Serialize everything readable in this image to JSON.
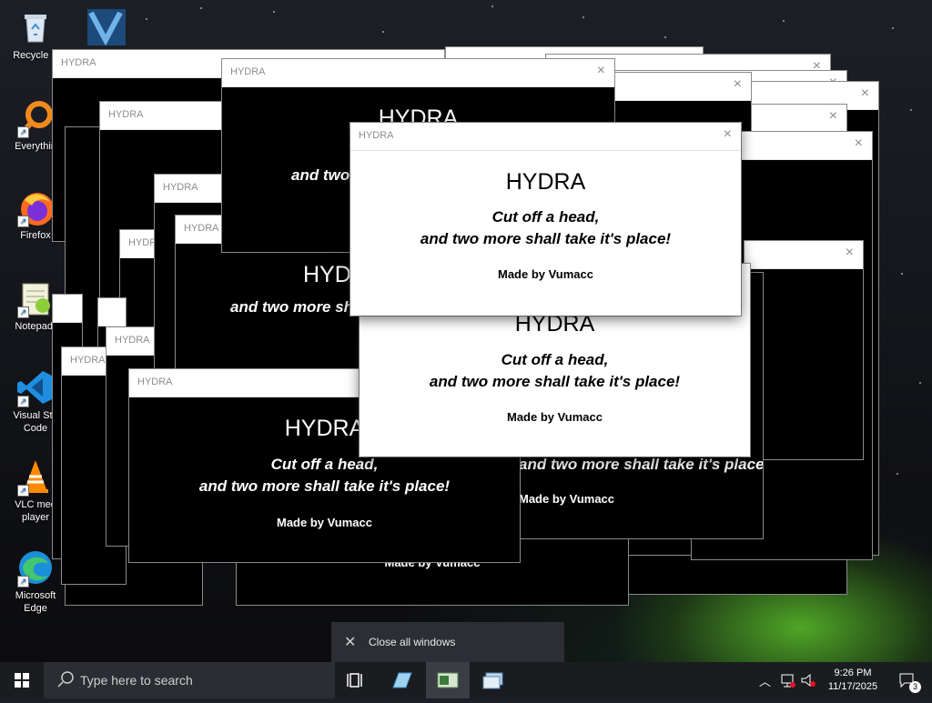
{
  "desktop_icons": [
    {
      "label": "Recycle B",
      "icon": "recycle-bin-icon"
    },
    {
      "label": "Everythin",
      "icon": "everything-search-icon"
    },
    {
      "label": "Firefox",
      "icon": "firefox-icon"
    },
    {
      "label": "Notepad-",
      "icon": "notepad-plus-icon"
    },
    {
      "label": "Visual Stu\nCode",
      "icon": "vscode-icon"
    },
    {
      "label": "VLC med\nplayer",
      "icon": "vlc-icon"
    },
    {
      "label": "Microsoft\nEdge",
      "icon": "edge-icon"
    }
  ],
  "hydra": {
    "window_title": "HYDRA",
    "heading": "HYDRA",
    "line1": "Cut off a head,",
    "line2": "and two more shall take it's place!",
    "credit": "Made by Vumacc",
    "close_glyph": "×"
  },
  "popup": {
    "label": "Close all windows"
  },
  "taskbar": {
    "search_placeholder": "Type here to search",
    "time": "9:26 PM",
    "date": "11/17/2025",
    "notification_count": "3"
  }
}
